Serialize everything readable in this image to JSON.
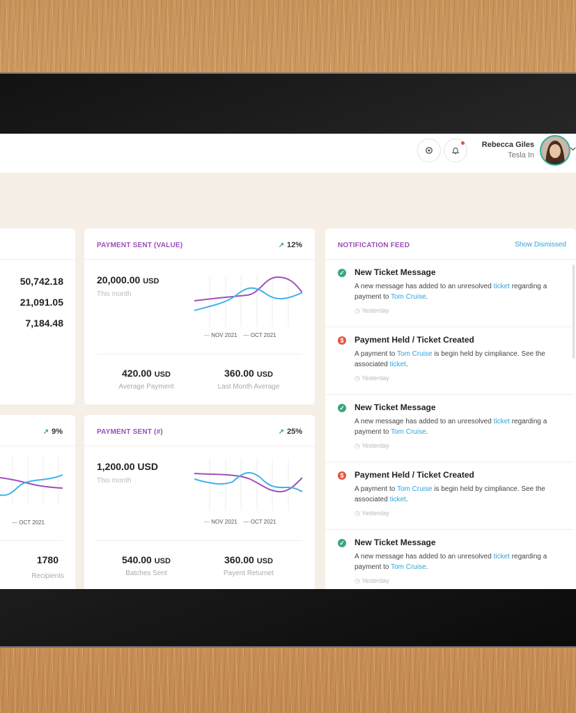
{
  "user": {
    "name": "Rebecca Giles",
    "company": "Tesla In"
  },
  "icons": {
    "settings": "gear-icon",
    "notifications": "bell-icon"
  },
  "left_card": {
    "values": [
      "50,742.18",
      "21,091.05",
      "7,184.48"
    ]
  },
  "payment_value": {
    "title": "PAYMENT SENT (VALUE)",
    "change": "12%",
    "main_value": "20,000.00",
    "main_unit": "USD",
    "period": "This month",
    "legend": [
      "NOV 2021",
      "OCT 2021"
    ],
    "stats": [
      {
        "value": "420.00",
        "unit": "USD",
        "label": "Average Payment"
      },
      {
        "value": "360.00",
        "unit": "USD",
        "label": "Last Month Average"
      }
    ]
  },
  "left_bottom_card": {
    "change": "9%",
    "legend": [
      "OCT 2021"
    ],
    "stat_value": "1780",
    "stat_label": "Recipients"
  },
  "payment_count": {
    "title": "PAYMENT SENT (#)",
    "change": "25%",
    "main_value": "1,200.00 USD",
    "period": "This month",
    "legend": [
      "NOV 2021",
      "OCT 2021"
    ],
    "stats": [
      {
        "value": "540.00",
        "unit": "USD",
        "label": "Batches Sent"
      },
      {
        "value": "360.00",
        "unit": "USD",
        "label": "Payent Returnet"
      }
    ]
  },
  "feed": {
    "title": "NOTIFICATION FEED",
    "action": "Show Dismissed",
    "items": [
      {
        "type": "ok",
        "title": "New Ticket Message",
        "text_a": "A new message has added to an unresolved ",
        "link_a": "ticket",
        "text_b": " regarding a payment to ",
        "link_b": "Tom Cruise",
        "text_c": ".",
        "time": "Yesterday"
      },
      {
        "type": "alert",
        "title": "Payment Held / Ticket Created",
        "text_a": "A payment to ",
        "link_a": "Tom Cruise",
        "text_b": " is begin held by cimpliance. See the associated ",
        "link_b": "ticket",
        "text_c": ".",
        "time": "Yesterday"
      },
      {
        "type": "ok",
        "title": "New Ticket Message",
        "text_a": "A new message has added to an unresolved ",
        "link_a": "ticket",
        "text_b": " regarding a payment to ",
        "link_b": "Tom Cruise",
        "text_c": ".",
        "time": "Yesterday"
      },
      {
        "type": "alert",
        "title": "Payment Held / Ticket Created",
        "text_a": "A payment to ",
        "link_a": "Tom Cruise",
        "text_b": " is begin held by cimpliance. See the associated ",
        "link_b": "ticket",
        "text_c": ".",
        "time": "Yesterday"
      },
      {
        "type": "ok",
        "title": "New Ticket Message",
        "text_a": "A new message has added to an unresolved ",
        "link_a": "ticket",
        "text_b": " regarding a payment to ",
        "link_b": "Tom Cruise",
        "text_c": ".",
        "time": "Yesterday"
      }
    ]
  },
  "colors": {
    "accent_purple": "#9a4fb8",
    "line_blue": "#3db3ec",
    "line_purple": "#a14fbf",
    "success": "#3aa67a",
    "alert": "#e5533f",
    "link": "#2aa3df"
  }
}
